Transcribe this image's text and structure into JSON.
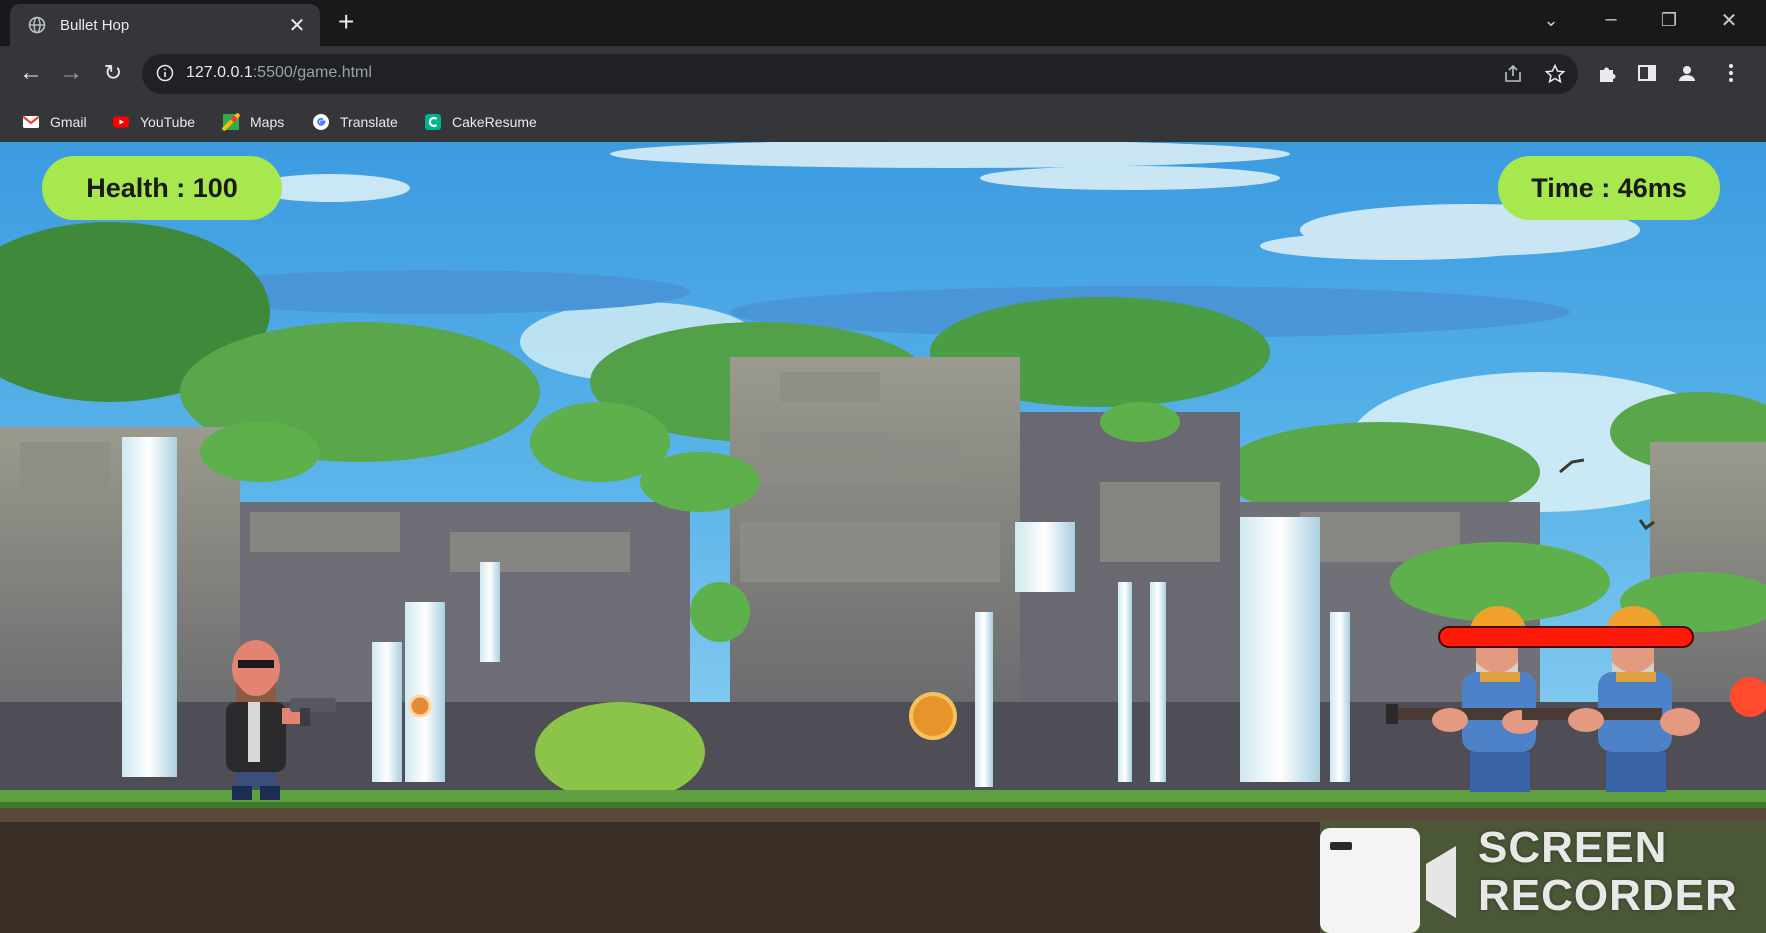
{
  "tab": {
    "title": "Bullet Hop",
    "close_icon": "close-icon"
  },
  "address_bar": {
    "host": "127.0.0.1",
    "path": ":5500/game.html"
  },
  "bookmarks": [
    {
      "label": "Gmail",
      "icon": "gmail-icon",
      "color": "#ea4335"
    },
    {
      "label": "YouTube",
      "icon": "youtube-icon",
      "color": "#ff0000"
    },
    {
      "label": "Maps",
      "icon": "maps-icon",
      "color": "#34a853"
    },
    {
      "label": "Translate",
      "icon": "translate-icon",
      "color": "#4285f4"
    },
    {
      "label": "CakeResume",
      "icon": "cakeresume-icon",
      "color": "#00b58a"
    }
  ],
  "hud": {
    "health_label": "Health : 100",
    "time_label": "Time : 46ms",
    "accent": "#a6e84d"
  },
  "enemy": {
    "health_fraction": 1.0,
    "bar_color": "#ff1a0a",
    "count": 2
  },
  "watermark": {
    "line1": "SCREEN",
    "line2": "RECORDER"
  }
}
